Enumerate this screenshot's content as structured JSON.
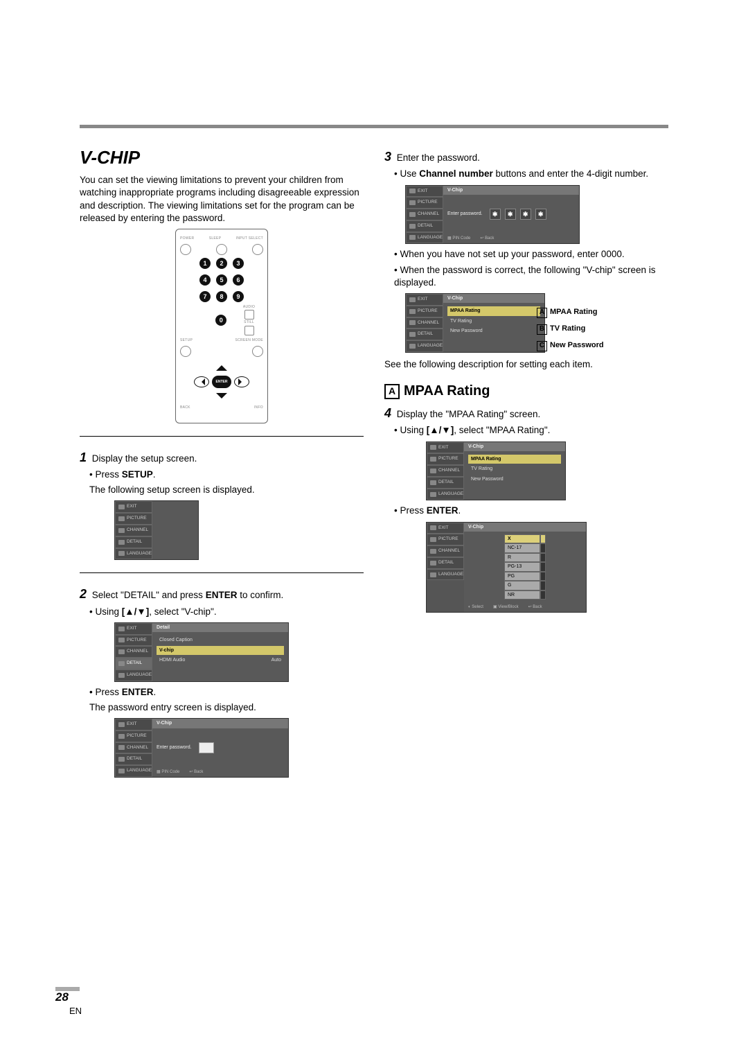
{
  "page": {
    "number": "28",
    "lang": "EN"
  },
  "left": {
    "heading": "V-CHIP",
    "intro": "You can set the viewing limitations to prevent your children from watching inappropriate programs including disagreeable expression and description. The viewing limitations set for the program can be released by entering the password.",
    "remote": {
      "top_labels": {
        "power": "POWER",
        "sleep": "SLEEP",
        "input": "INPUT SELECT"
      },
      "numbers": [
        "1",
        "2",
        "3",
        "4",
        "5",
        "6",
        "7",
        "8",
        "9",
        "0"
      ],
      "side_labels": {
        "audio": "AUDIO",
        "still": "STILL"
      },
      "bottom_labels": {
        "setup": "SETUP",
        "screen": "SCREEN MODE",
        "back": "BACK",
        "info": "INFO"
      },
      "enter": "ENTER"
    },
    "step1": {
      "text": "Display the setup screen.",
      "bullet_pre": "• Press ",
      "bullet_bold": "SETUP",
      "bullet_post": ".",
      "note": "The following setup screen is displayed."
    },
    "step2": {
      "line_pre": "Select \"DETAIL\" and press ",
      "line_bold": "ENTER",
      "line_post": " to confirm.",
      "bullet_pre": "• Using ",
      "bullet_bold": "[▲/▼]",
      "bullet_post": ", select \"V-chip\".",
      "bullet2_pre": "• Press ",
      "bullet2_bold": "ENTER",
      "bullet2_post": ".",
      "note2": "The password entry screen is displayed."
    },
    "osd_tabs": [
      "EXIT",
      "PICTURE",
      "CHANNEL",
      "DETAIL",
      "LANGUAGE"
    ],
    "osd_detail": {
      "title": "Detail",
      "items": {
        "cc": "Closed Caption",
        "vchip": "V-chip",
        "hdmi": "HDMI Audio",
        "hdmi_val": "Auto"
      }
    },
    "osd_pw": {
      "title": "V-Chip",
      "prompt": "Enter password.",
      "foot_pin": "PIN Code",
      "foot_back": "Back"
    }
  },
  "right": {
    "step3": {
      "text": "Enter the password.",
      "bullet_pre": "• Use ",
      "bullet_bold": "Channel number",
      "bullet_post": " buttons and enter the 4-digit number."
    },
    "note1": "• When you have not set up your password, enter 0000.",
    "note2": "• When the password is correct, the following \"V-chip\" screen is displayed.",
    "osd_vchip": {
      "title": "V-Chip",
      "items": [
        "MPAA Rating",
        "TV Rating",
        "New Password"
      ]
    },
    "callouts": {
      "A": "MPAA Rating",
      "B": "TV Rating",
      "C": "New Password"
    },
    "see": "See the following description for setting each item.",
    "subhead": "MPAA Rating",
    "step4": {
      "text": "Display the \"MPAA Rating\" screen.",
      "bullet_pre": "• Using ",
      "bullet_bold": "[▲/▼]",
      "bullet_post": ", select \"MPAA Rating\".",
      "bullet2_pre": "• Press ",
      "bullet2_bold": "ENTER",
      "bullet2_post": "."
    },
    "ratings": [
      "X",
      "NC-17",
      "R",
      "PG-13",
      "PG",
      "G",
      "NR"
    ],
    "osd_ratings_footer": {
      "select": "Select",
      "view": "View/Block",
      "back": "Back"
    }
  },
  "chart_data": {
    "type": "table",
    "title": "MPAA rating levels shown in on-screen menu",
    "categories": [
      "X",
      "NC-17",
      "R",
      "PG-13",
      "PG",
      "G",
      "NR"
    ]
  }
}
